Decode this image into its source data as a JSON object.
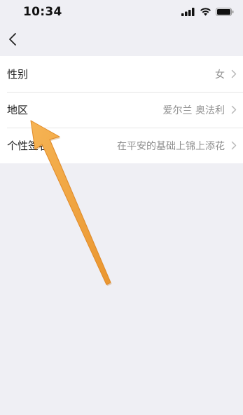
{
  "status_bar": {
    "time": "10:34",
    "icons": [
      "signal-icon",
      "wifi-icon",
      "battery-icon"
    ]
  },
  "nav": {
    "back_icon": "chevron-left-icon"
  },
  "settings": {
    "rows": [
      {
        "label": "性别",
        "value": "女"
      },
      {
        "label": "地区",
        "value": "爱尔兰 奥法利"
      },
      {
        "label": "个性签名",
        "value": "在平安的基础上锦上添花"
      }
    ]
  },
  "annotation": {
    "type": "arrow",
    "color": "#f0a040",
    "points_to": "地区"
  },
  "colors": {
    "background": "#efeff4",
    "row_background": "#ffffff",
    "value_text": "#8f8f8f",
    "arrow": "#f0a040"
  }
}
